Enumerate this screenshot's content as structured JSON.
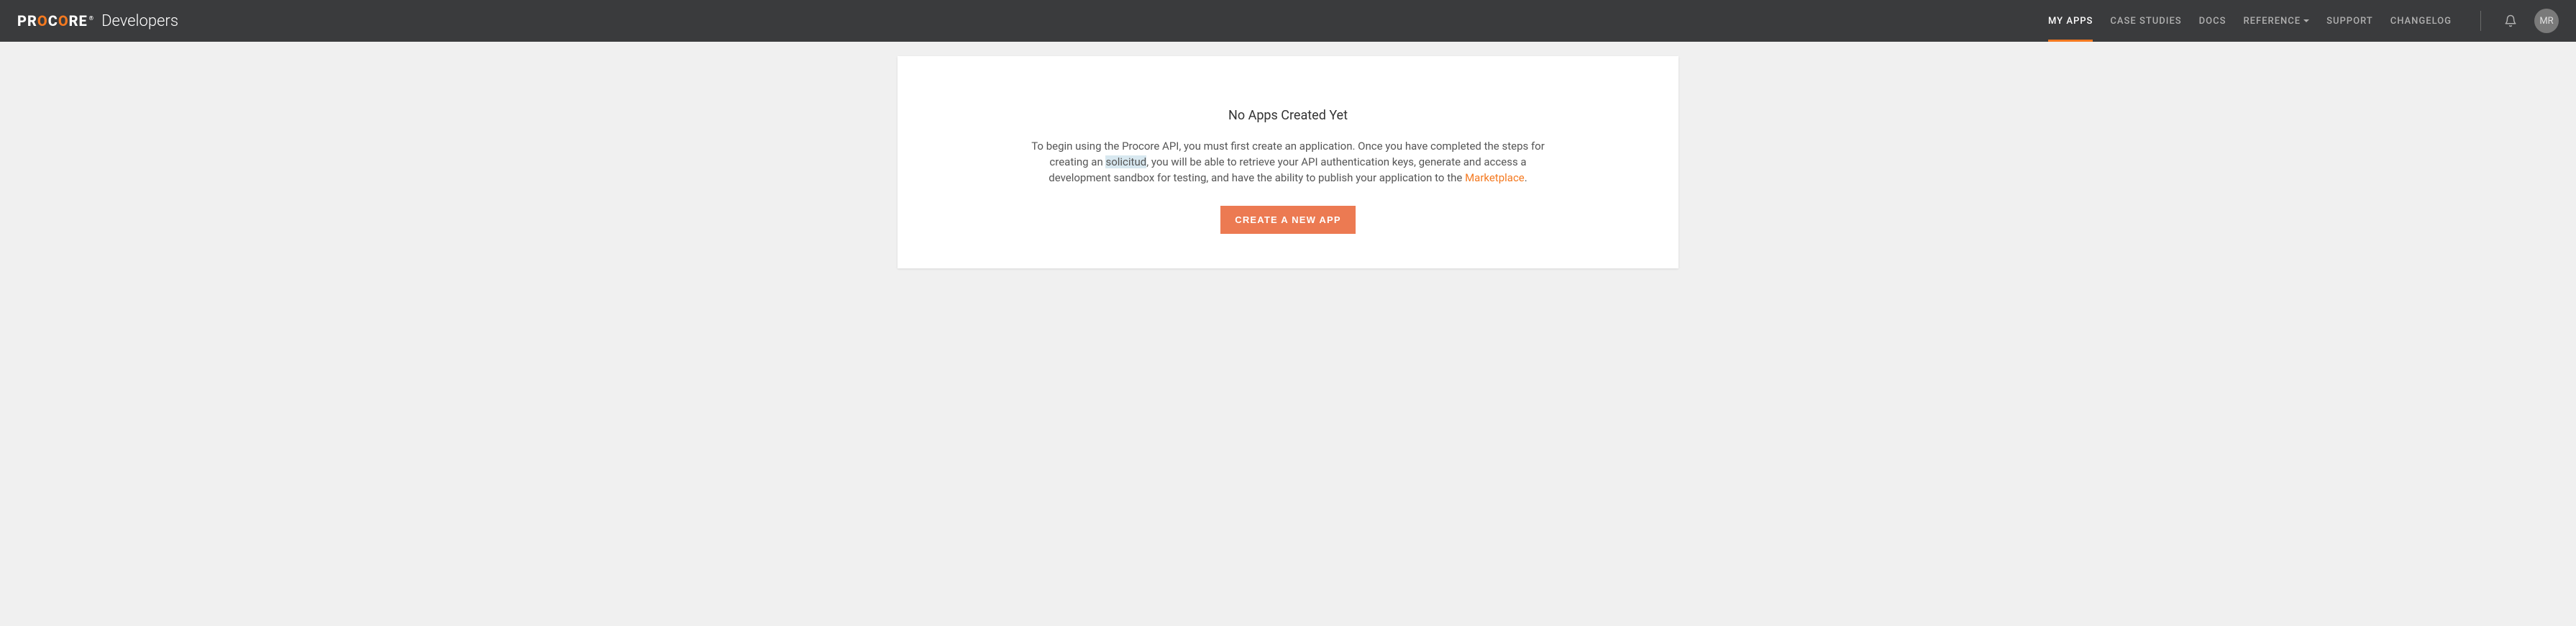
{
  "header": {
    "logo": {
      "brand": "PROCORE",
      "suffix": "Developers"
    },
    "nav": {
      "my_apps": "MY APPS",
      "case_studies": "CASE STUDIES",
      "docs": "DOCS",
      "reference": "REFERENCE",
      "support": "SUPPORT",
      "changelog": "CHANGELOG"
    },
    "avatar_initials": "MR"
  },
  "main": {
    "heading": "No Apps Created Yet",
    "description_part1": "To begin using the Procore API, you must first create an application. Once you have completed the steps for creating an ",
    "description_highlight": "solicitud",
    "description_part2": ", you will be able to retrieve your API authentication keys, generate and access a development sandbox for testing, and have the ability to publish your application to the ",
    "description_link": "Marketplace",
    "description_part3": ".",
    "button_label": "CREATE A NEW APP"
  }
}
